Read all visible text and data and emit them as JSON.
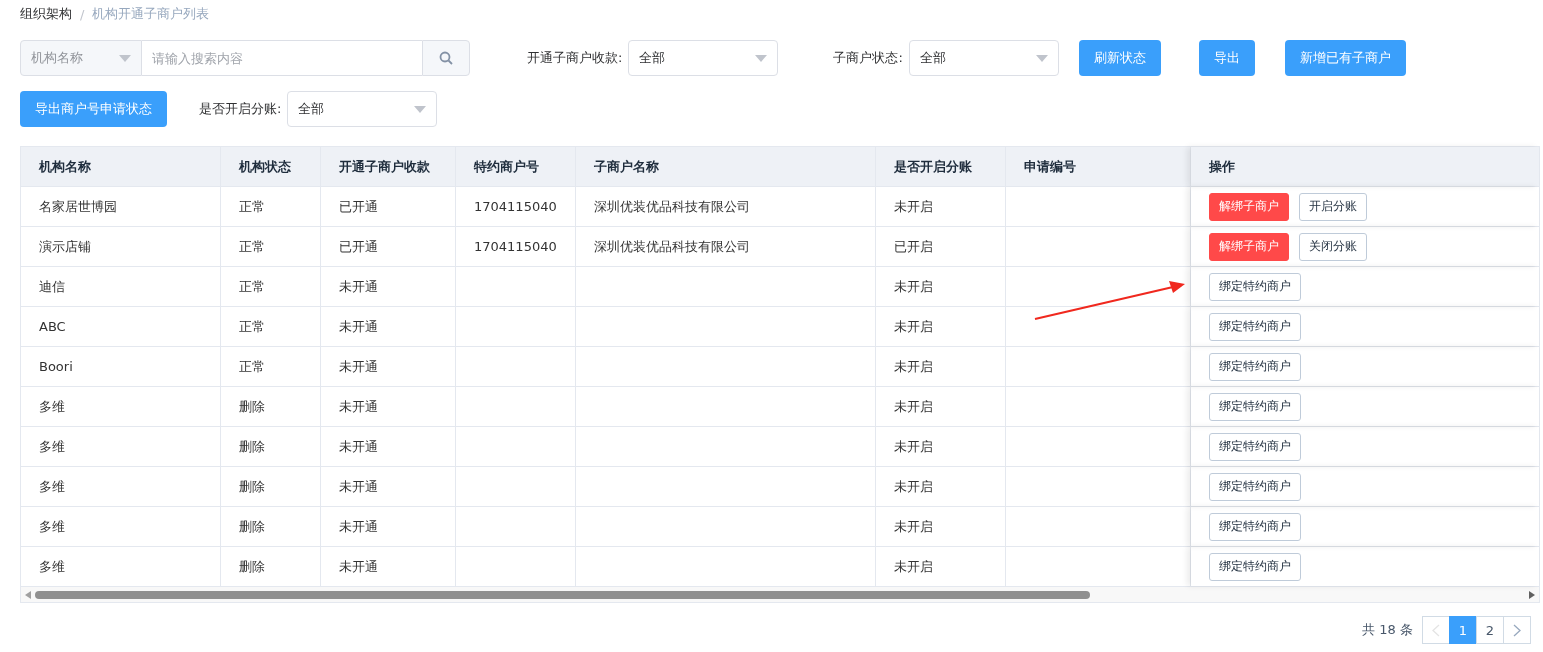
{
  "breadcrumb_separator": "/",
  "breadcrumb": [
    {
      "label": "组织架构",
      "current": false
    },
    {
      "label": "机构开通子商户列表",
      "current": true
    }
  ],
  "search": {
    "field_select": "机构名称",
    "placeholder": "请输入搜索内容"
  },
  "filters": [
    {
      "label": "开通子商户收款:",
      "value": "全部"
    },
    {
      "label": "子商户状态:",
      "value": "全部"
    }
  ],
  "buttons": [
    "刷新状态",
    "导出",
    "新增已有子商户",
    "导出商户号申请状态"
  ],
  "filter_split": {
    "label": "是否开启分账:",
    "value": "全部"
  },
  "table": {
    "columns": [
      "机构名称",
      "机构状态",
      "开通子商户收款",
      "特约商户号",
      "子商户名称",
      "是否开启分账",
      "申请编号",
      "操作"
    ],
    "rows": [
      {
        "cells": [
          "名家居世博园",
          "正常",
          "已开通",
          "1704115040",
          "深圳优装优品科技有限公司",
          "未开启",
          ""
        ],
        "actions": [
          {
            "kind": "danger",
            "label": "解绑子商户"
          },
          {
            "kind": "default",
            "label": "开启分账"
          }
        ]
      },
      {
        "cells": [
          "演示店铺",
          "正常",
          "已开通",
          "1704115040",
          "深圳优装优品科技有限公司",
          "已开启",
          ""
        ],
        "actions": [
          {
            "kind": "danger",
            "label": "解绑子商户"
          },
          {
            "kind": "default",
            "label": "关闭分账"
          }
        ]
      },
      {
        "cells": [
          "迪信",
          "正常",
          "未开通",
          "",
          "",
          "未开启",
          ""
        ],
        "actions": [
          {
            "kind": "default",
            "label": "绑定特约商户"
          }
        ]
      },
      {
        "cells": [
          "ABC",
          "正常",
          "未开通",
          "",
          "",
          "未开启",
          ""
        ],
        "actions": [
          {
            "kind": "default",
            "label": "绑定特约商户"
          }
        ]
      },
      {
        "cells": [
          "Boori",
          "正常",
          "未开通",
          "",
          "",
          "未开启",
          ""
        ],
        "actions": [
          {
            "kind": "default",
            "label": "绑定特约商户"
          }
        ]
      },
      {
        "cells": [
          "多维",
          "删除",
          "未开通",
          "",
          "",
          "未开启",
          ""
        ],
        "actions": [
          {
            "kind": "default",
            "label": "绑定特约商户"
          }
        ]
      },
      {
        "cells": [
          "多维",
          "删除",
          "未开通",
          "",
          "",
          "未开启",
          ""
        ],
        "actions": [
          {
            "kind": "default",
            "label": "绑定特约商户"
          }
        ]
      },
      {
        "cells": [
          "多维",
          "删除",
          "未开通",
          "",
          "",
          "未开启",
          ""
        ],
        "actions": [
          {
            "kind": "default",
            "label": "绑定特约商户"
          }
        ]
      },
      {
        "cells": [
          "多维",
          "删除",
          "未开通",
          "",
          "",
          "未开启",
          ""
        ],
        "actions": [
          {
            "kind": "default",
            "label": "绑定特约商户"
          }
        ]
      },
      {
        "cells": [
          "多维",
          "删除",
          "未开通",
          "",
          "",
          "未开启",
          ""
        ],
        "actions": [
          {
            "kind": "default",
            "label": "绑定特约商户"
          }
        ]
      }
    ]
  },
  "pagination": {
    "total": "共 18 条",
    "prev_disabled": true,
    "pages": [
      {
        "label": "1",
        "selected": true
      },
      {
        "label": "2",
        "selected": false
      }
    ]
  }
}
